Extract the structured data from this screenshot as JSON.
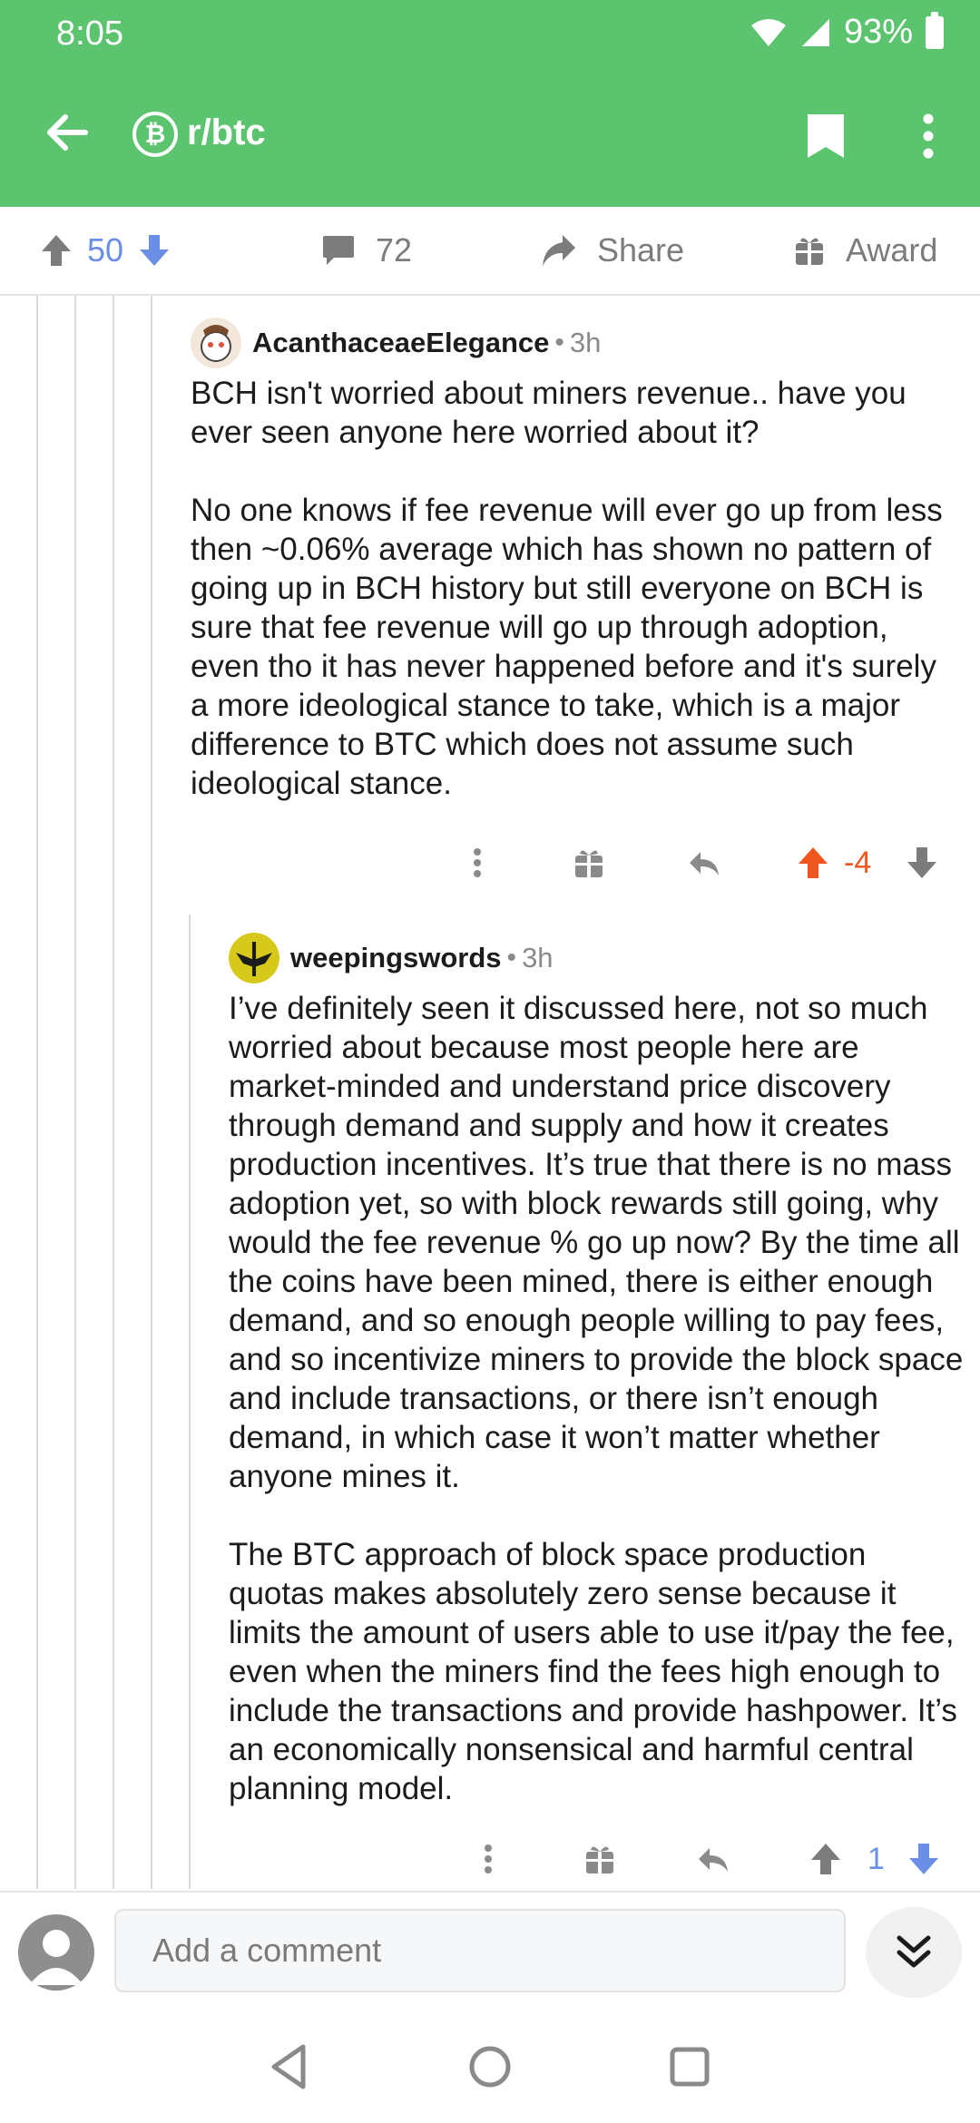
{
  "status": {
    "time": "8:05",
    "battery": "93%"
  },
  "header": {
    "subreddit": "r/btc",
    "badge_symbol": "₿"
  },
  "post_actions": {
    "score": "50",
    "comments": "72",
    "share": "Share",
    "award": "Award"
  },
  "comments": [
    {
      "user": "AcanthaceaeElegance",
      "dot": "•",
      "time": "3h",
      "paragraphs": [
        "BCH isn't worried about miners revenue.. have you ever seen anyone here worried about it?",
        "No one knows if fee revenue will ever go up from less then ~0.06% average which has shown no pattern of going up in BCH history but still everyone on BCH is sure that fee revenue will go up through adoption, even tho it has never happened before and it's surely a more ideological stance to take, which is a major difference to BTC which does not assume such ideological stance."
      ],
      "score": "-4"
    },
    {
      "user": "weepingswords",
      "dot": "•",
      "time": "3h",
      "paragraphs": [
        "I’ve definitely seen it discussed here, not so much worried about because most people here are market-minded and understand price discovery through demand and supply and how it creates production incentives. It’s true that there is no mass adoption yet, so with block rewards still going, why would the fee revenue % go up now? By the time all the coins have been mined, there is either enough demand, and so enough people willing to pay fees, and so incentivize miners to provide the block space and include transactions, or there isn’t enough demand, in which case it won’t matter whether anyone mines it.",
        "The BTC approach of block space production quotas makes absolutely zero sense because it limits the amount of users able to use it/pay the fee, even when the miners find the fees high enough to include the transactions and provide hashpower. It’s an economically nonsensical and harmful central planning model."
      ],
      "score": "1"
    }
  ],
  "composer": {
    "placeholder": "Add a comment"
  },
  "colors": {
    "header_bg": "#5cc46f",
    "upvote_active": "#f0561d",
    "vote_blue": "#6b8fe6",
    "muted": "#7c7c7c"
  }
}
